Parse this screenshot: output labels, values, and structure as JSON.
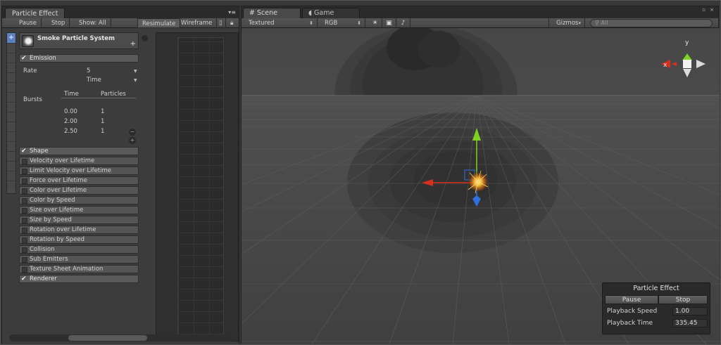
{
  "left_panel": {
    "tab_title": "Particle Effect",
    "toolbar": {
      "pause": "Pause",
      "stop": "Stop",
      "show": "Show: All",
      "resimulate": "Resimulate",
      "wireframe": "Wireframe"
    },
    "system_name": "Smoke Particle System",
    "emission": {
      "label": "Emission",
      "rate_label": "Rate",
      "rate_value": "5",
      "rate_mode": "Time",
      "bursts_label": "Bursts",
      "bursts_columns": [
        "Time",
        "Particles"
      ],
      "bursts": [
        {
          "time": "0.00",
          "particles": "1"
        },
        {
          "time": "2.00",
          "particles": "1"
        },
        {
          "time": "2.50",
          "particles": "1"
        }
      ]
    },
    "modules": [
      {
        "label": "Shape",
        "enabled": true
      },
      {
        "label": "Velocity over Lifetime",
        "enabled": false
      },
      {
        "label": "Limit Velocity over Lifetime",
        "enabled": false
      },
      {
        "label": "Force over Lifetime",
        "enabled": false
      },
      {
        "label": "Color over Lifetime",
        "enabled": false
      },
      {
        "label": "Color by Speed",
        "enabled": false
      },
      {
        "label": "Size over Lifetime",
        "enabled": false
      },
      {
        "label": "Size by Speed",
        "enabled": false
      },
      {
        "label": "Rotation over Lifetime",
        "enabled": false
      },
      {
        "label": "Rotation by Speed",
        "enabled": false
      },
      {
        "label": "Collision",
        "enabled": false
      },
      {
        "label": "Sub Emitters",
        "enabled": false
      },
      {
        "label": "Texture Sheet Animation",
        "enabled": false
      },
      {
        "label": "Renderer",
        "enabled": true
      }
    ]
  },
  "scene_panel": {
    "tabs": [
      {
        "label": "Scene",
        "icon": "scene-grid-icon"
      },
      {
        "label": "Game",
        "icon": "game-pacman-icon"
      }
    ],
    "toolbar": {
      "render_mode": "Textured",
      "channel": "RGB",
      "gizmos": "Gizmos",
      "search_placeholder": "All"
    },
    "gizmo_labels": {
      "x": "x",
      "y": "y"
    },
    "overlay": {
      "title": "Particle Effect",
      "pause": "Pause",
      "stop": "Stop",
      "playback_speed_label": "Playback Speed",
      "playback_speed": "1.00",
      "playback_time_label": "Playback Time",
      "playback_time": "335.45"
    }
  },
  "colors": {
    "x_axis": "#d8301e",
    "y_axis": "#7ed321",
    "z_axis": "#2f6fe0",
    "selection": "#5c7fbf"
  }
}
